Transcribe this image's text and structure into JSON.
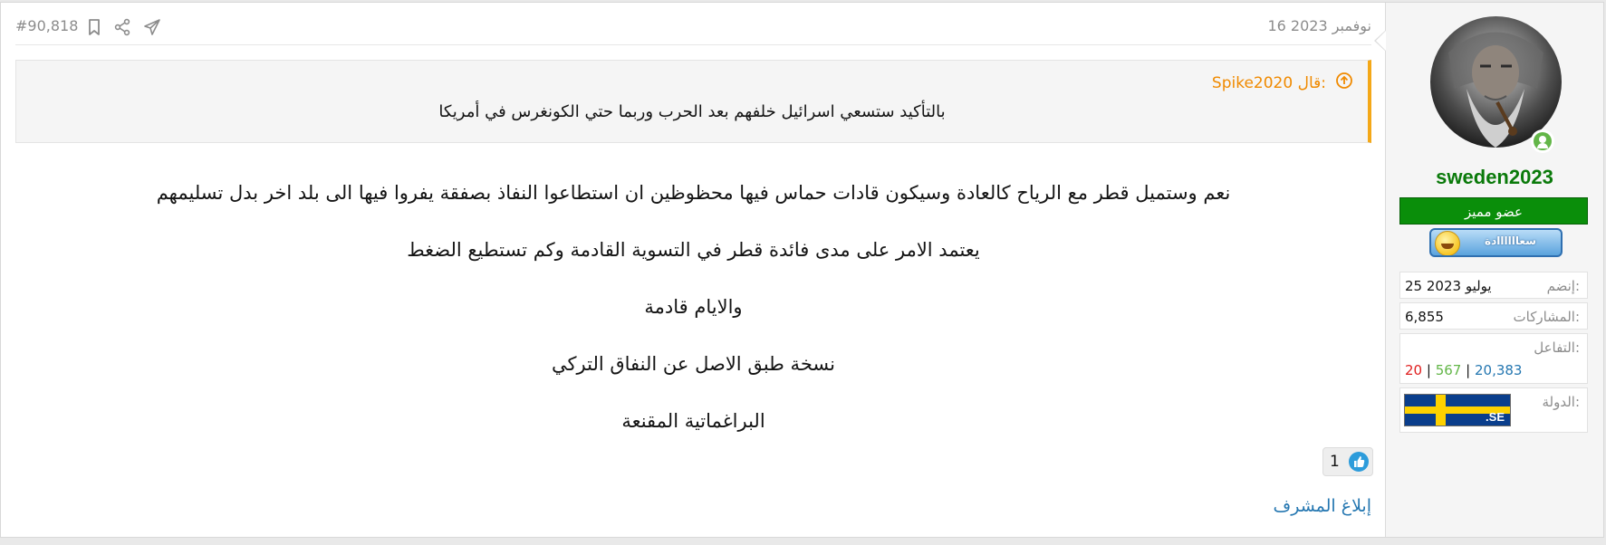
{
  "post": {
    "date": "16 نوفمبر 2023",
    "number": "#90,818",
    "quote": {
      "author_line": "Spike2020 قال:",
      "text": "بالتأكيد ستسعي اسرائيل خلفهم بعد الحرب وربما حتي الكونغرس في أمريكا"
    },
    "paragraphs": [
      "نعم وستميل قطر مع الرياح كالعادة وسيكون قادات حماس فيها محظوظين ان استطاعوا النفاذ بصفقة يفروا فيها الى بلد اخر بدل تسليمهم",
      "يعتمد الامر على مدى فائدة قطر في التسوية القادمة وكم تستطيع الضغط",
      "والايام قادمة",
      "نسخة طبق الاصل عن النفاق التركي",
      "البراغماتية المقنعة"
    ],
    "reaction_count": "1",
    "report_label": "إبلاغ المشرف"
  },
  "user": {
    "name": "sweden2023",
    "rank": "عضو مميز",
    "award_text": "سعاااااادة",
    "joined_label": "إنضم:",
    "joined_value": "25 يوليو 2023",
    "posts_label": "المشاركات:",
    "posts_value": "6,855",
    "reactions_label": "التفاعل:",
    "reactions": {
      "positive": "20,383",
      "neutral": "567",
      "negative": "20"
    },
    "country_label": "الدولة:",
    "country_flag_text": ".SE"
  },
  "colors": {
    "username": "#0a7a0a",
    "rank_bg": "#0a8e0a",
    "quote_accent": "#f4a818",
    "link": "#2577b1"
  }
}
